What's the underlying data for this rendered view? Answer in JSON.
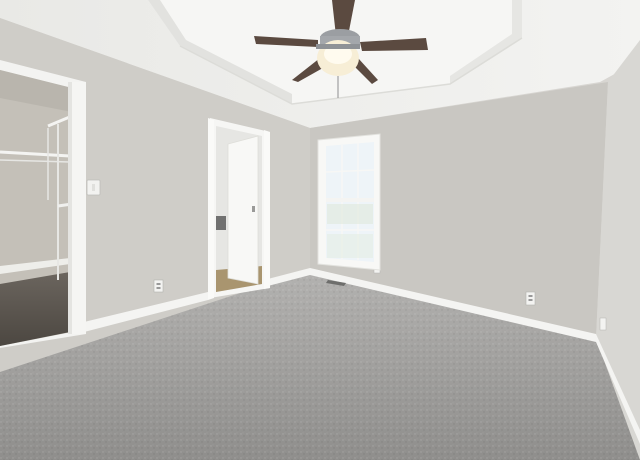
{
  "scene": {
    "colors": {
      "wall_left": "#cfcdc8",
      "wall_back": "#c9c7c2",
      "wall_right": "#d9d8d4",
      "ceiling": "#efefec",
      "tray": "#f6f6f4",
      "trim": "#f7f7f5",
      "carpet": "#9e9d9b",
      "carpet_dark": "#8a8987",
      "closet_floor": "#5a544e",
      "closet_wall": "#c4c0b8",
      "fan_blade": "#5b4a40",
      "fan_metal": "#9b9ea2",
      "glass": "#eef4f8"
    },
    "icons": [
      "ceiling-fan-icon",
      "light-switch-icon",
      "outlet-icon",
      "floor-vent-icon"
    ]
  }
}
